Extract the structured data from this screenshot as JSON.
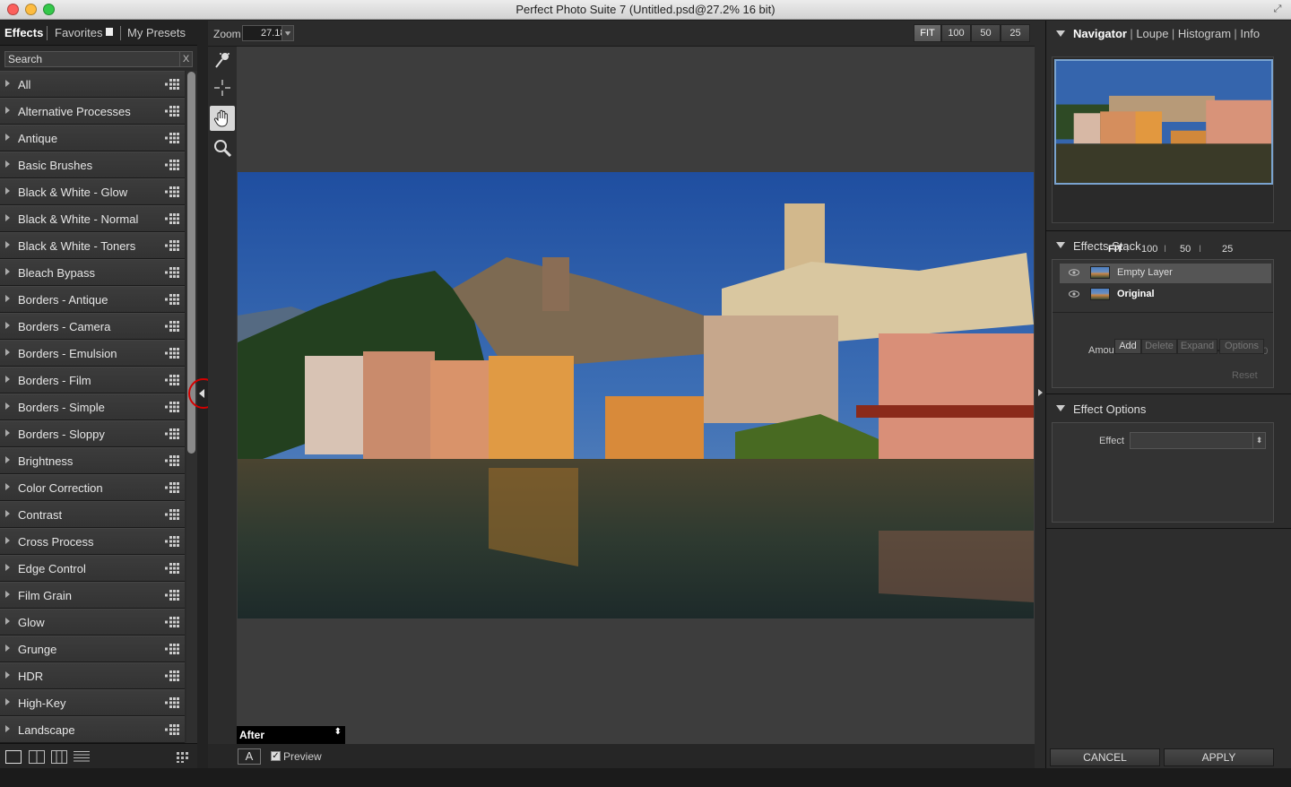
{
  "window": {
    "title": "Perfect Photo Suite 7 (Untitled.psd@27.2% 16 bit)"
  },
  "left_panel": {
    "tabs": [
      {
        "label": "Effects"
      },
      {
        "label": "Favorites"
      },
      {
        "label": "My Presets"
      }
    ],
    "search": {
      "placeholder": "Search",
      "clear_label": "X"
    },
    "categories": [
      "All",
      "Alternative Processes",
      "Antique",
      "Basic Brushes",
      "Black & White - Glow",
      "Black & White - Normal",
      "Black & White - Toners",
      "Bleach Bypass",
      "Borders - Antique",
      "Borders - Camera",
      "Borders - Emulsion",
      "Borders - Film",
      "Borders - Simple",
      "Borders - Sloppy",
      "Brightness",
      "Color Correction",
      "Contrast",
      "Cross Process",
      "Edge Control",
      "Film Grain",
      "Glow",
      "Grunge",
      "HDR",
      "High-Key",
      "Landscape"
    ]
  },
  "zoombar": {
    "label": "Zoom",
    "value": "27.18",
    "presets": [
      "FIT",
      "100",
      "50",
      "25"
    ],
    "active_preset": "FIT"
  },
  "canvas": {
    "view_select": "After",
    "a_button": "A",
    "preview_label": "Preview",
    "preview_checked": "✓"
  },
  "right_panel": {
    "nav_tabs": [
      "Navigator",
      "Loupe",
      "Histogram",
      "Info"
    ],
    "nav_zoom": [
      "FIT",
      "100",
      "50",
      "25"
    ],
    "effects_stack": {
      "title": "Effects Stack",
      "layers": [
        "Empty Layer",
        "Original"
      ],
      "buttons": [
        "Add",
        "Delete",
        "Expand",
        "Options"
      ],
      "amount_label": "Amount",
      "amount_value": "100",
      "reset_label": "Reset"
    },
    "effect_options": {
      "title": "Effect Options",
      "effect_label": "Effect",
      "effect_value": ""
    },
    "footer": {
      "cancel": "CANCEL",
      "apply": "APPLY"
    }
  },
  "colors": {
    "accent_ring": "#d40000",
    "selection_blue": "#7aa3cf"
  }
}
